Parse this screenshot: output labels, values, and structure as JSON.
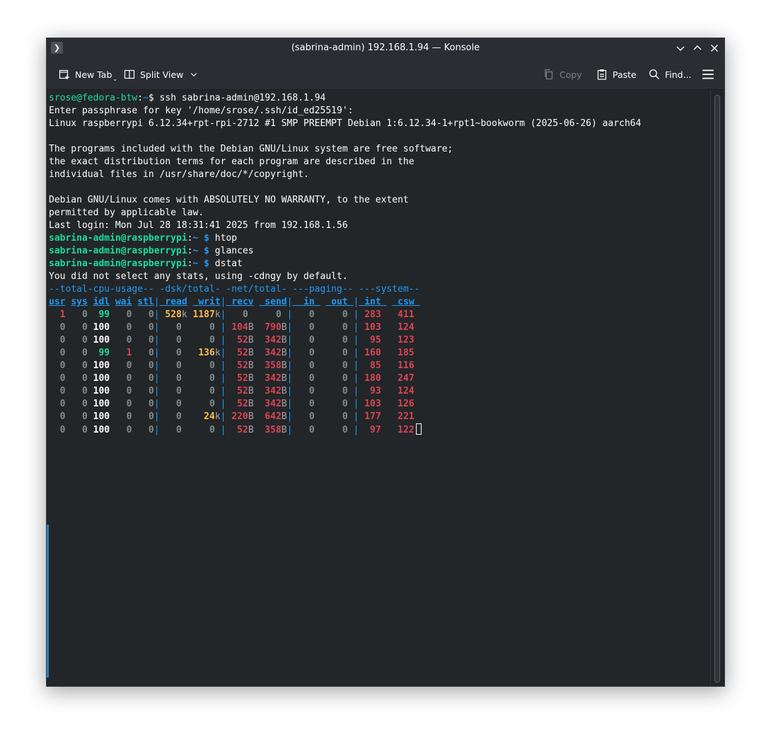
{
  "window": {
    "title": "(sabrina-admin) 192.168.1.94 — Konsole"
  },
  "toolbar": {
    "new_tab": "New Tab",
    "split_view": "Split View",
    "copy": "Copy",
    "paste": "Paste",
    "find": "Find..."
  },
  "colors": {
    "background": "#232629",
    "prompt_green": "#1cdc9a",
    "header_blue": "#1d99f3",
    "value_red": "#da4453",
    "value_yellow": "#fdbc4b"
  },
  "terminal": {
    "lines": [
      [
        [
          "srose@fedora-btw",
          "c-green"
        ],
        [
          ":",
          ""
        ],
        [
          "~",
          "c-blue"
        ],
        [
          "$ ssh sabrina-admin@192.168.1.94",
          ""
        ]
      ],
      [
        [
          "Enter passphrase for key '/home/srose/.ssh/id_ed25519':",
          ""
        ]
      ],
      [
        [
          "Linux raspberrypi 6.12.34+rpt-rpi-2712 #1 SMP PREEMPT Debian 1:6.12.34-1+rpt1~bookworm (2025-06-26) aarch64",
          ""
        ]
      ],
      [],
      [
        [
          "The programs included with the Debian GNU/Linux system are free software;",
          ""
        ]
      ],
      [
        [
          "the exact distribution terms for each program are described in the",
          ""
        ]
      ],
      [
        [
          "individual files in /usr/share/doc/*/copyright.",
          ""
        ]
      ],
      [],
      [
        [
          "Debian GNU/Linux comes with ABSOLUTELY NO WARRANTY, to the extent",
          ""
        ]
      ],
      [
        [
          "permitted by applicable law.",
          ""
        ]
      ],
      [
        [
          "Last login: Mon Jul 28 18:31:41 2025 from 192.168.1.56",
          ""
        ]
      ],
      [
        [
          "sabrina-admin@raspberrypi",
          "c-greenb"
        ],
        [
          ":",
          ""
        ],
        [
          "~ $",
          "c-blueb"
        ],
        [
          " htop",
          ""
        ]
      ],
      [
        [
          "sabrina-admin@raspberrypi",
          "c-greenb"
        ],
        [
          ":",
          ""
        ],
        [
          "~ $",
          "c-blueb"
        ],
        [
          " glances",
          ""
        ]
      ],
      [
        [
          "sabrina-admin@raspberrypi",
          "c-greenb"
        ],
        [
          ":",
          ""
        ],
        [
          "~ $",
          "c-blueb"
        ],
        [
          " dstat",
          ""
        ]
      ],
      [
        [
          "You did not select any stats, using -cdngy by default.",
          ""
        ]
      ],
      [
        [
          "--total-cpu-usage-- -dsk/total- -net/total- ---paging-- ---system--",
          "c-blue"
        ]
      ],
      [
        [
          "usr",
          "c-blueu"
        ],
        [
          " ",
          ""
        ],
        [
          "sys",
          "c-blueu"
        ],
        [
          " ",
          ""
        ],
        [
          "idl",
          "c-blueu"
        ],
        [
          " ",
          ""
        ],
        [
          "wai",
          "c-blueu"
        ],
        [
          " ",
          ""
        ],
        [
          "stl",
          "c-blueu"
        ],
        [
          "|",
          "c-sep"
        ],
        [
          " read",
          "c-blueu"
        ],
        [
          " ",
          ""
        ],
        [
          " writ",
          "c-blueu"
        ],
        [
          "|",
          "c-sep"
        ],
        [
          " recv",
          "c-blueu"
        ],
        [
          " ",
          ""
        ],
        [
          " send",
          "c-blueu"
        ],
        [
          "|",
          "c-sep"
        ],
        [
          "  in ",
          "c-blueu"
        ],
        [
          " ",
          ""
        ],
        [
          " out ",
          "c-blueu"
        ],
        [
          "|",
          "c-sep"
        ],
        [
          " int ",
          "c-blueu"
        ],
        [
          " ",
          ""
        ],
        [
          " csw ",
          "c-blueu"
        ]
      ],
      [
        [
          "  1",
          "c-rred"
        ],
        [
          "   0",
          "c-grayb"
        ],
        [
          "  99",
          "c-greenb"
        ],
        [
          "   0",
          "c-grayb"
        ],
        [
          "   0",
          "c-grayb"
        ],
        [
          "|",
          "c-sep"
        ],
        [
          " 528",
          "c-yel"
        ],
        [
          "k",
          "c-gray"
        ],
        [
          " 1187",
          "c-yel"
        ],
        [
          "k",
          "c-gray"
        ],
        [
          "|",
          "c-sep"
        ],
        [
          "   0",
          "c-grayb"
        ],
        [
          "     0",
          "c-grayb"
        ],
        [
          " |",
          "c-sep"
        ],
        [
          "   0",
          "c-grayb"
        ],
        [
          "     0",
          "c-grayb"
        ],
        [
          " |",
          "c-sep"
        ],
        [
          " 283",
          "c-rred"
        ],
        [
          "   411",
          "c-rred"
        ]
      ],
      [
        [
          "  0",
          "c-grayb"
        ],
        [
          "   0",
          "c-grayb"
        ],
        [
          " 100",
          "c-white"
        ],
        [
          "   0",
          "c-grayb"
        ],
        [
          "   0",
          "c-grayb"
        ],
        [
          "|",
          "c-sep"
        ],
        [
          "   0",
          "c-grayb"
        ],
        [
          "     0",
          "c-grayb"
        ],
        [
          " |",
          "c-sep"
        ],
        [
          " 104",
          "c-rred"
        ],
        [
          "B",
          "c-gray"
        ],
        [
          "  790",
          "c-rred"
        ],
        [
          "B",
          "c-gray"
        ],
        [
          "|",
          "c-sep"
        ],
        [
          "   0",
          "c-grayb"
        ],
        [
          "     0",
          "c-grayb"
        ],
        [
          " |",
          "c-sep"
        ],
        [
          " 103",
          "c-rred"
        ],
        [
          "   124",
          "c-rred"
        ]
      ],
      [
        [
          "  0",
          "c-grayb"
        ],
        [
          "   0",
          "c-grayb"
        ],
        [
          " 100",
          "c-white"
        ],
        [
          "   0",
          "c-grayb"
        ],
        [
          "   0",
          "c-grayb"
        ],
        [
          "|",
          "c-sep"
        ],
        [
          "   0",
          "c-grayb"
        ],
        [
          "     0",
          "c-grayb"
        ],
        [
          " |",
          "c-sep"
        ],
        [
          "  52",
          "c-rred"
        ],
        [
          "B",
          "c-gray"
        ],
        [
          "  342",
          "c-rred"
        ],
        [
          "B",
          "c-gray"
        ],
        [
          "|",
          "c-sep"
        ],
        [
          "   0",
          "c-grayb"
        ],
        [
          "     0",
          "c-grayb"
        ],
        [
          " |",
          "c-sep"
        ],
        [
          "  95",
          "c-rred"
        ],
        [
          "   123",
          "c-rred"
        ]
      ],
      [
        [
          "  0",
          "c-grayb"
        ],
        [
          "   0",
          "c-grayb"
        ],
        [
          "  99",
          "c-greenb"
        ],
        [
          "   1",
          "c-rred"
        ],
        [
          "   0",
          "c-grayb"
        ],
        [
          "|",
          "c-sep"
        ],
        [
          "   0",
          "c-grayb"
        ],
        [
          "   136",
          "c-yel"
        ],
        [
          "k",
          "c-gray"
        ],
        [
          "|",
          "c-sep"
        ],
        [
          "  52",
          "c-rred"
        ],
        [
          "B",
          "c-gray"
        ],
        [
          "  342",
          "c-rred"
        ],
        [
          "B",
          "c-gray"
        ],
        [
          "|",
          "c-sep"
        ],
        [
          "   0",
          "c-grayb"
        ],
        [
          "     0",
          "c-grayb"
        ],
        [
          " |",
          "c-sep"
        ],
        [
          " 160",
          "c-rred"
        ],
        [
          "   185",
          "c-rred"
        ]
      ],
      [
        [
          "  0",
          "c-grayb"
        ],
        [
          "   0",
          "c-grayb"
        ],
        [
          " 100",
          "c-white"
        ],
        [
          "   0",
          "c-grayb"
        ],
        [
          "   0",
          "c-grayb"
        ],
        [
          "|",
          "c-sep"
        ],
        [
          "   0",
          "c-grayb"
        ],
        [
          "     0",
          "c-grayb"
        ],
        [
          " |",
          "c-sep"
        ],
        [
          "  52",
          "c-rred"
        ],
        [
          "B",
          "c-gray"
        ],
        [
          "  358",
          "c-rred"
        ],
        [
          "B",
          "c-gray"
        ],
        [
          "|",
          "c-sep"
        ],
        [
          "   0",
          "c-grayb"
        ],
        [
          "     0",
          "c-grayb"
        ],
        [
          " |",
          "c-sep"
        ],
        [
          "  85",
          "c-rred"
        ],
        [
          "   116",
          "c-rred"
        ]
      ],
      [
        [
          "  0",
          "c-grayb"
        ],
        [
          "   0",
          "c-grayb"
        ],
        [
          " 100",
          "c-white"
        ],
        [
          "   0",
          "c-grayb"
        ],
        [
          "   0",
          "c-grayb"
        ],
        [
          "|",
          "c-sep"
        ],
        [
          "   0",
          "c-grayb"
        ],
        [
          "     0",
          "c-grayb"
        ],
        [
          " |",
          "c-sep"
        ],
        [
          "  52",
          "c-rred"
        ],
        [
          "B",
          "c-gray"
        ],
        [
          "  342",
          "c-rred"
        ],
        [
          "B",
          "c-gray"
        ],
        [
          "|",
          "c-sep"
        ],
        [
          "   0",
          "c-grayb"
        ],
        [
          "     0",
          "c-grayb"
        ],
        [
          " |",
          "c-sep"
        ],
        [
          " 180",
          "c-rred"
        ],
        [
          "   247",
          "c-rred"
        ]
      ],
      [
        [
          "  0",
          "c-grayb"
        ],
        [
          "   0",
          "c-grayb"
        ],
        [
          " 100",
          "c-white"
        ],
        [
          "   0",
          "c-grayb"
        ],
        [
          "   0",
          "c-grayb"
        ],
        [
          "|",
          "c-sep"
        ],
        [
          "   0",
          "c-grayb"
        ],
        [
          "     0",
          "c-grayb"
        ],
        [
          " |",
          "c-sep"
        ],
        [
          "  52",
          "c-rred"
        ],
        [
          "B",
          "c-gray"
        ],
        [
          "  342",
          "c-rred"
        ],
        [
          "B",
          "c-gray"
        ],
        [
          "|",
          "c-sep"
        ],
        [
          "   0",
          "c-grayb"
        ],
        [
          "     0",
          "c-grayb"
        ],
        [
          " |",
          "c-sep"
        ],
        [
          "  93",
          "c-rred"
        ],
        [
          "   124",
          "c-rred"
        ]
      ],
      [
        [
          "  0",
          "c-grayb"
        ],
        [
          "   0",
          "c-grayb"
        ],
        [
          " 100",
          "c-white"
        ],
        [
          "   0",
          "c-grayb"
        ],
        [
          "   0",
          "c-grayb"
        ],
        [
          "|",
          "c-sep"
        ],
        [
          "   0",
          "c-grayb"
        ],
        [
          "     0",
          "c-grayb"
        ],
        [
          " |",
          "c-sep"
        ],
        [
          "  52",
          "c-rred"
        ],
        [
          "B",
          "c-gray"
        ],
        [
          "  342",
          "c-rred"
        ],
        [
          "B",
          "c-gray"
        ],
        [
          "|",
          "c-sep"
        ],
        [
          "   0",
          "c-grayb"
        ],
        [
          "     0",
          "c-grayb"
        ],
        [
          " |",
          "c-sep"
        ],
        [
          " 103",
          "c-rred"
        ],
        [
          "   126",
          "c-rred"
        ]
      ],
      [
        [
          "  0",
          "c-grayb"
        ],
        [
          "   0",
          "c-grayb"
        ],
        [
          " 100",
          "c-white"
        ],
        [
          "   0",
          "c-grayb"
        ],
        [
          "   0",
          "c-grayb"
        ],
        [
          "|",
          "c-sep"
        ],
        [
          "   0",
          "c-grayb"
        ],
        [
          "    24",
          "c-yel"
        ],
        [
          "k",
          "c-gray"
        ],
        [
          "|",
          "c-sep"
        ],
        [
          " 220",
          "c-rred"
        ],
        [
          "B",
          "c-gray"
        ],
        [
          "  642",
          "c-rred"
        ],
        [
          "B",
          "c-gray"
        ],
        [
          "|",
          "c-sep"
        ],
        [
          "   0",
          "c-grayb"
        ],
        [
          "     0",
          "c-grayb"
        ],
        [
          " |",
          "c-sep"
        ],
        [
          " 177",
          "c-rred"
        ],
        [
          "   221",
          "c-rred"
        ]
      ],
      [
        [
          "  0",
          "c-grayb"
        ],
        [
          "   0",
          "c-grayb"
        ],
        [
          " 100",
          "c-white"
        ],
        [
          "   0",
          "c-grayb"
        ],
        [
          "   0",
          "c-grayb"
        ],
        [
          "|",
          "c-sep"
        ],
        [
          "   0",
          "c-grayb"
        ],
        [
          "     0",
          "c-grayb"
        ],
        [
          " |",
          "c-sep"
        ],
        [
          "  52",
          "c-rred"
        ],
        [
          "B",
          "c-gray"
        ],
        [
          "  358",
          "c-rred"
        ],
        [
          "B",
          "c-gray"
        ],
        [
          "|",
          "c-sep"
        ],
        [
          "   0",
          "c-grayb"
        ],
        [
          "     0",
          "c-grayb"
        ],
        [
          " |",
          "c-sep"
        ],
        [
          "  97",
          "c-rred"
        ],
        [
          "   122",
          "c-rred"
        ],
        [
          "CURSOR",
          "cursor"
        ]
      ]
    ]
  }
}
